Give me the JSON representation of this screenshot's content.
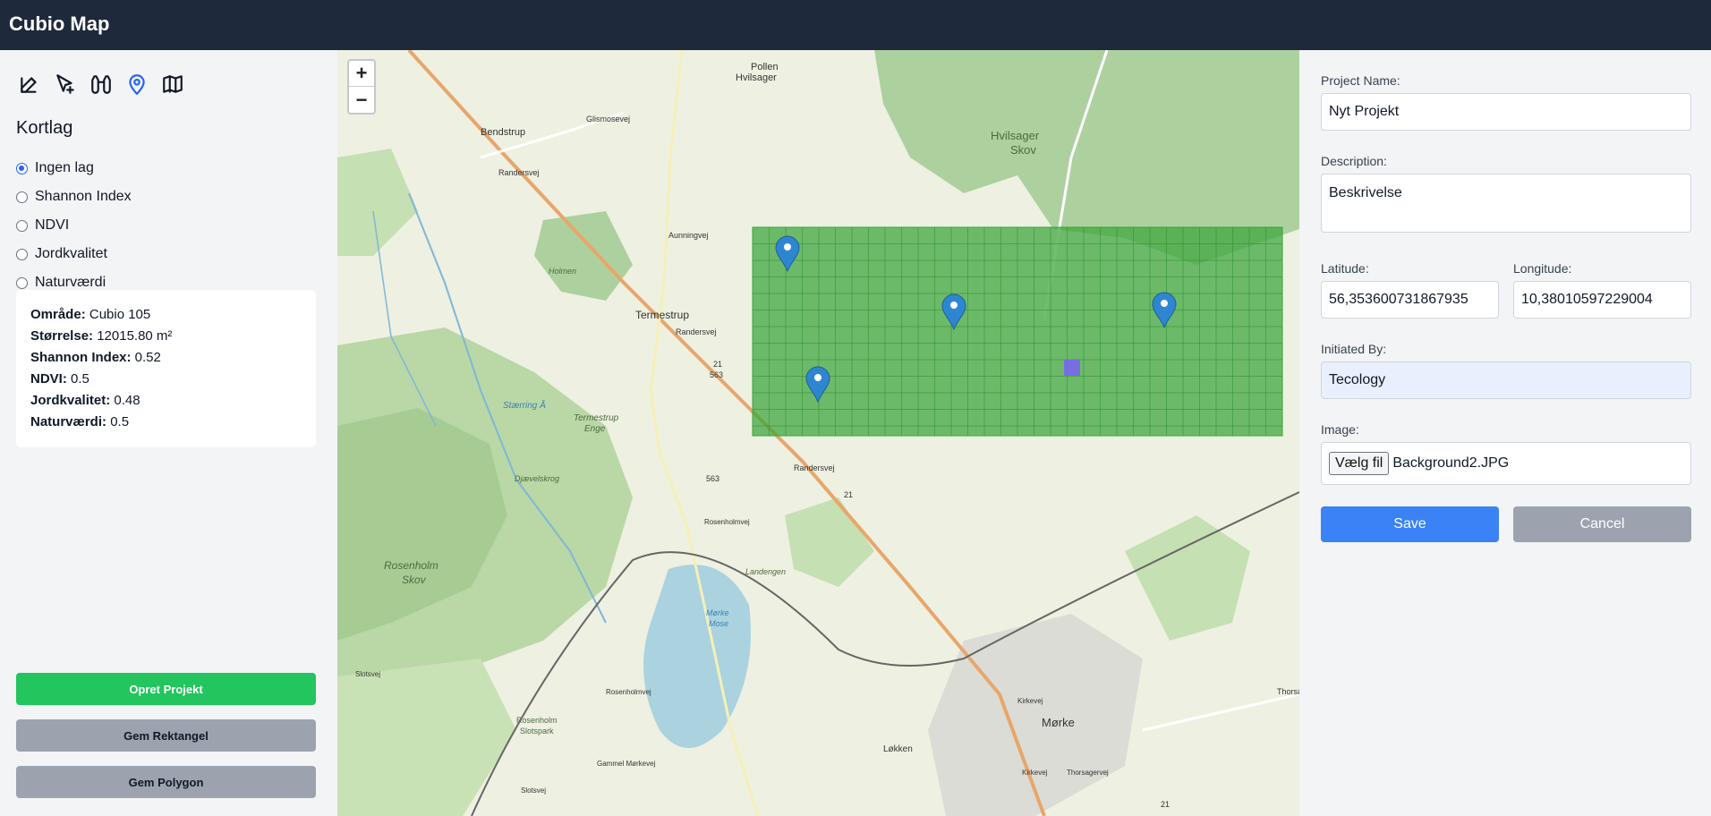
{
  "app": {
    "title": "Cubio Map"
  },
  "toolbar": {
    "tools": [
      {
        "name": "edit-icon"
      },
      {
        "name": "select-add-icon"
      },
      {
        "name": "binoculars-icon"
      },
      {
        "name": "map-pin-icon",
        "active": true
      },
      {
        "name": "map-fold-icon"
      }
    ],
    "active_color": "#2563eb"
  },
  "layers": {
    "title": "Kortlag",
    "options": [
      {
        "label": "Ingen lag",
        "checked": true
      },
      {
        "label": "Shannon Index",
        "checked": false
      },
      {
        "label": "NDVI",
        "checked": false
      },
      {
        "label": "Jordkvalitet",
        "checked": false
      },
      {
        "label": "Naturværdi",
        "checked": false
      }
    ]
  },
  "info": {
    "area_label": "Område:",
    "area_value": "Cubio 105",
    "size_label": "Størrelse:",
    "size_value": "12015.80 m²",
    "shannon_label": "Shannon Index:",
    "shannon_value": "0.52",
    "ndvi_label": "NDVI:",
    "ndvi_value": "0.5",
    "soil_label": "Jordkvalitet:",
    "soil_value": "0.48",
    "nature_label": "Naturværdi:",
    "nature_value": "0.5"
  },
  "buttons": {
    "create_project": "Opret Projekt",
    "save_rect": "Gem Rektangel",
    "save_polygon": "Gem Polygon",
    "create_color": "#22c55e",
    "gray_color": "#9ca3af"
  },
  "map": {
    "zoom_in": "+",
    "zoom_out": "−",
    "labels": [
      "Pollen",
      "Hvilsager",
      "Bendstrup",
      "Glismosevej",
      "Randersvej",
      "Hvilsager",
      "Skov",
      "Aunningvej",
      "Holmen",
      "Termestrup",
      "Randersvej",
      "21",
      "563",
      "Termestrup",
      "Enge",
      "Stærring Å",
      "Djævelskrog",
      "563",
      "Rosenholmvej",
      "21",
      "Randersvej",
      "Rosenholm",
      "Skov",
      "Landengen",
      "Mørke",
      "Mose",
      "Rosenholmvej",
      "Slotsvej",
      "Rosenholm",
      "Slotspark",
      "Gammel Mørkevej",
      "Slotsvej",
      "Løkken",
      "Mørke",
      "Kirkevej",
      "Kirkevej",
      "Thorsagervej",
      "Thorsa",
      "21"
    ],
    "grid_color": "#3aa53a",
    "highlight_color": "#7b5cff",
    "marker_color": "#2f86d0",
    "marker_count": 4
  },
  "form": {
    "project_name_label": "Project Name:",
    "project_name_value": "Nyt Projekt",
    "description_label": "Description:",
    "description_value": "Beskrivelse",
    "latitude_label": "Latitude:",
    "latitude_value": "56,353600731867935",
    "longitude_label": "Longitude:",
    "longitude_value": "10,38010597229004",
    "initiated_label": "Initiated By:",
    "initiated_value": "Tecology",
    "image_label": "Image:",
    "file_button": "Vælg fil",
    "file_name": "Background2.JPG",
    "save": "Save",
    "cancel": "Cancel",
    "save_color": "#3b82f6"
  }
}
